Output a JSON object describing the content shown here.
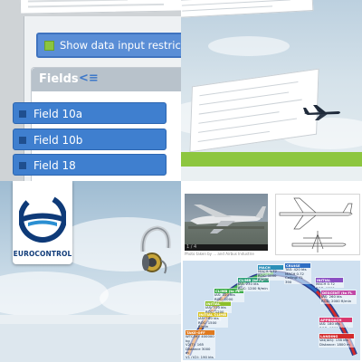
{
  "form": {
    "restriction_button_label": "Show data input restriction",
    "fields_title": "Fields",
    "collapse_icon": "double-chevron-left-icon",
    "fields": [
      "Field 10a",
      "Field 10b",
      "Field 18"
    ]
  },
  "logo": {
    "brand": "EUROCONTROL"
  },
  "photo": {
    "counter": "1 / 4",
    "caption": "Photo taken by ... and Airbus Industrie"
  },
  "flight_phases": [
    {
      "name": "TAKE-OFF",
      "color": "#e07a1f",
      "lines": [
        "WTC(M): 400000 kg",
        "V2(T): 165",
        "Distance 3000 m",
        "V1 (V2): 190 kts"
      ]
    },
    {
      "name": "INITIAL CLIMB (to 5000 ft)",
      "color": "#d9c21f",
      "lines": [
        "IAS: 160 kts",
        "ROC: 1500 ft/min"
      ]
    },
    {
      "name": "INITIAL CLIMB",
      "color": "#8dbf2a",
      "lines": [
        "IAS: 220 kts",
        "ROC: 1200 ft/min"
      ]
    },
    {
      "name": "CLIMB (to FL 150)",
      "color": "#3fae4a",
      "lines": [
        "IAS: 220 kts",
        "ROC: 1000 ft/min"
      ]
    },
    {
      "name": "CLIMB (to FL 240)",
      "color": "#2fa07b",
      "lines": [
        "IAS: 230 kts",
        "ROC: 1200 ft/min"
      ]
    },
    {
      "name": "MACH CLIMB",
      "color": "#2a8fb8",
      "lines": [
        "MACH 0.72",
        "ROC: 1000 ft/min"
      ]
    },
    {
      "name": "CRUISE",
      "color": "#2f6fc4",
      "lines": [
        "TAS: 420 kts",
        "MACH 0.72",
        "Ceiling: FL 390",
        "Range: 5900 NM"
      ]
    },
    {
      "name": "INITIAL DESCENT",
      "color": "#8a4fc2",
      "lines": [
        "MACH 0.72",
        "ROD: 1500 ft/min"
      ]
    },
    {
      "name": "DESCENT (to FL 100)",
      "color": "#c247a6",
      "lines": [
        "IAS: 260 kts",
        "ROD: 2000 ft/min"
      ]
    },
    {
      "name": "APPROACH",
      "color": "#d9386e",
      "lines": [
        "IAS: 180 kts",
        "ROD: 1500 ft/min"
      ]
    },
    {
      "name": "LANDING",
      "color": "#d42b2b",
      "lines": [
        "Vat(IAS): 138 kts",
        "Distance: 1800 m"
      ]
    }
  ]
}
